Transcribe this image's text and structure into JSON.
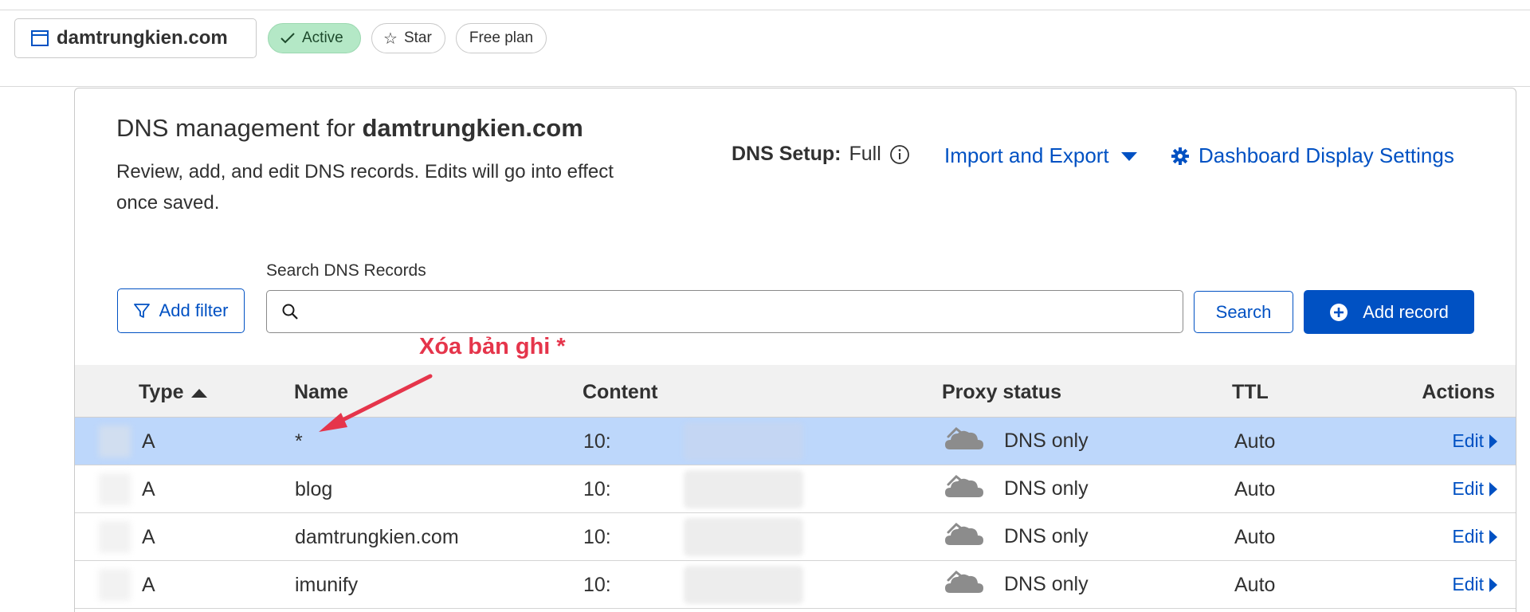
{
  "header": {
    "zone_name": "damtrungkien.com",
    "status": "Active",
    "star_label": "Star",
    "plan": "Free plan"
  },
  "dns": {
    "title_prefix": "DNS management for",
    "title_domain": "damtrungkien.com",
    "description": "Review, add, and edit DNS records. Edits will go into effect once saved.",
    "setup_label": "DNS Setup:",
    "setup_value": "Full",
    "import_export": "Import and Export",
    "dashboard_settings": "Dashboard Display Settings"
  },
  "toolbar": {
    "add_filter": "Add filter",
    "search_label": "Search DNS Records",
    "search_placeholder": "",
    "search_button": "Search",
    "add_record": "Add record"
  },
  "annotation": "Xóa bản ghi *",
  "table": {
    "columns": [
      "Type",
      "Name",
      "Content",
      "Proxy status",
      "TTL",
      "Actions"
    ],
    "rows": [
      {
        "type": "A",
        "name": "*",
        "content": "10:",
        "proxy": "DNS only",
        "ttl": "Auto",
        "action": "Edit"
      },
      {
        "type": "A",
        "name": "blog",
        "content": "10:",
        "proxy": "DNS only",
        "ttl": "Auto",
        "action": "Edit"
      },
      {
        "type": "A",
        "name": "damtrungkien.com",
        "content": "10:",
        "proxy": "DNS only",
        "ttl": "Auto",
        "action": "Edit"
      },
      {
        "type": "A",
        "name": "imunify",
        "content": "10:",
        "proxy": "DNS only",
        "ttl": "Auto",
        "action": "Edit"
      }
    ]
  },
  "colors": {
    "accent": "#0051c3",
    "active_bg": "#b4e8c6",
    "selected_row": "#bdd7fb",
    "annotation": "#e5354b"
  }
}
